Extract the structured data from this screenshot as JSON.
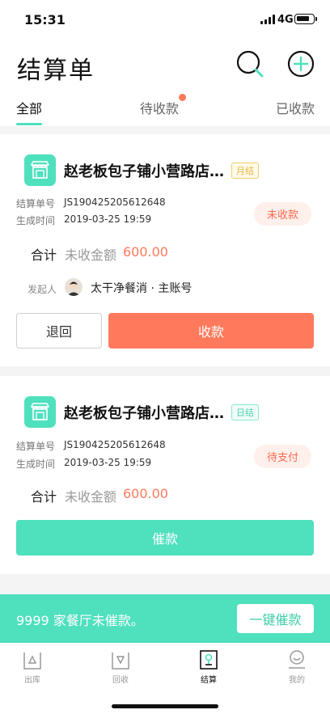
{
  "status_bar": {
    "time": "15:31",
    "network": "4G"
  },
  "header": {
    "title": "结算单",
    "search_icon": "search-icon",
    "add_icon": "plus-circle-icon"
  },
  "tabs": [
    {
      "label": "全部",
      "active": true
    },
    {
      "label": "待收款",
      "active": false,
      "has_dot": true
    },
    {
      "label": "已收款",
      "active": false
    }
  ],
  "cards": [
    {
      "shop_name": "赵老板包子铺小营路店…",
      "tag": "月结",
      "order_no_label": "结算单号",
      "order_no": "JS190425205612648",
      "created_label": "生成时间",
      "created": "2019-03-25 19:59",
      "status": "未收款",
      "sum_label": "合计",
      "sum_sub": "未收金额",
      "amount": "600.00",
      "initiator_label": "发起人",
      "initiator_name": "太干净餐消 · 主账号",
      "reject_label": "退回",
      "collect_label": "收款"
    },
    {
      "shop_name": "赵老板包子铺小营路店…",
      "tag": "日结",
      "order_no_label": "结算单号",
      "order_no": "JS190425205612648",
      "created_label": "生成时间",
      "created": "2019-03-25 19:59",
      "status": "待支付",
      "sum_label": "合计",
      "sum_sub": "未收金额",
      "amount": "600.00",
      "urge_label": "催款"
    }
  ],
  "banner": {
    "text": "9999 家餐厅未催款。",
    "button": "一键催款"
  },
  "bottom_nav": [
    {
      "label": "出库",
      "icon": "outbound-icon",
      "active": false
    },
    {
      "label": "回收",
      "icon": "recycle-icon",
      "active": false
    },
    {
      "label": "结算",
      "icon": "settlement-icon",
      "active": true
    },
    {
      "label": "我的",
      "icon": "profile-icon",
      "active": false
    }
  ],
  "colors": {
    "accent": "#4fe0be",
    "alert": "#ff7a5c"
  }
}
